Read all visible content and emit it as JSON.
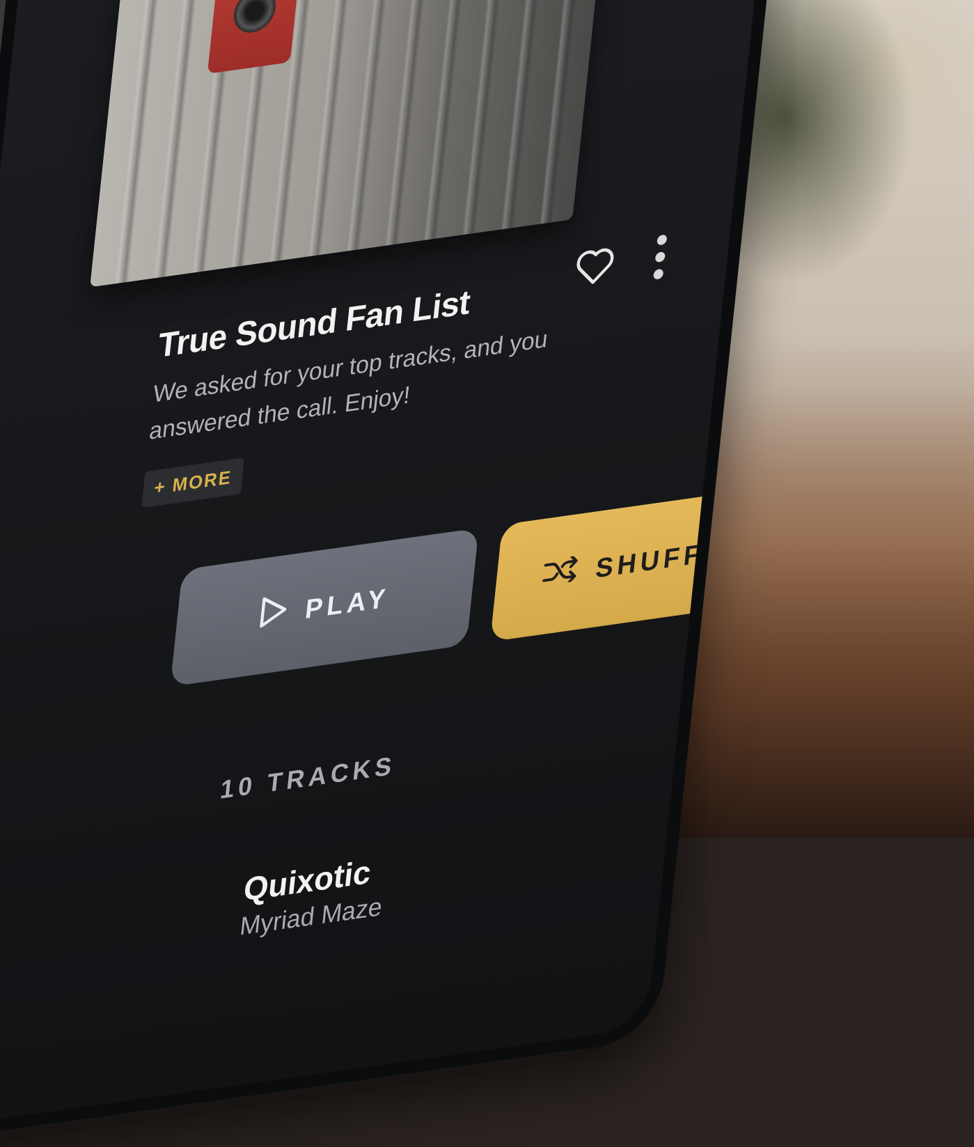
{
  "playlist": {
    "title": "True Sound Fan List",
    "description": "We asked for your top tracks, and you answered the call. Enjoy!",
    "more_label": "+ MORE"
  },
  "actions": {
    "play_label": "PLAY",
    "shuffle_label": "SHUFFLE"
  },
  "icons": {
    "favorite": "heart-outline-icon",
    "more_options": "vertical-dots-icon",
    "play": "play-triangle-icon",
    "shuffle": "shuffle-arrows-icon"
  },
  "tracks": {
    "count_label": "10 TRACKS",
    "items": [
      {
        "title": "Quixotic",
        "artist": "Myriad Maze"
      }
    ]
  },
  "colors": {
    "accent_gold": "#D8B14F",
    "play_button": "#666873",
    "shuffle_button": "#DDB252",
    "screen_bg": "#1A1B1E"
  }
}
